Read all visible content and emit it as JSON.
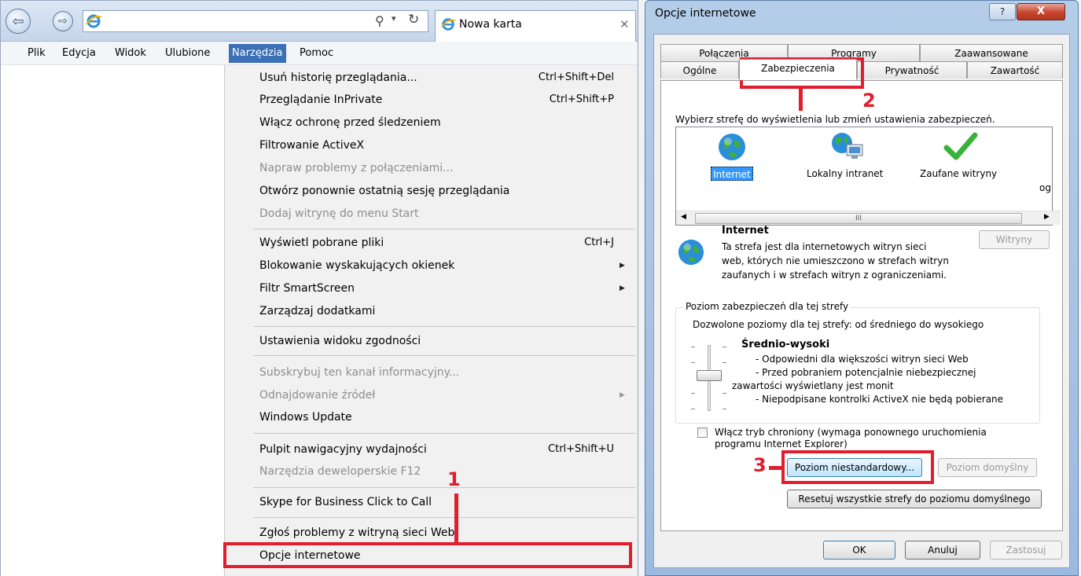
{
  "browser": {
    "tab_title": "Nowa karta",
    "menubar": [
      "Plik",
      "Edycja",
      "Widok",
      "Ulubione",
      "Narzędzia",
      "Pomoc"
    ],
    "tools_menu": [
      {
        "label": "Usuń historię przeglądania...",
        "shortcut": "Ctrl+Shift+Del"
      },
      {
        "label": "Przeglądanie InPrivate",
        "shortcut": "Ctrl+Shift+P"
      },
      {
        "label": "Włącz ochronę przed śledzeniem"
      },
      {
        "label": "Filtrowanie ActiveX"
      },
      {
        "label": "Napraw problemy z połączeniami...",
        "disabled": true
      },
      {
        "label": "Otwórz ponownie ostatnią sesję przeglądania"
      },
      {
        "label": "Dodaj witrynę do menu Start",
        "disabled": true
      },
      {
        "label": "Wyświetl pobrane pliki",
        "shortcut": "Ctrl+J"
      },
      {
        "label": "Blokowanie wyskakujących okienek",
        "submenu": true
      },
      {
        "label": "Filtr SmartScreen",
        "submenu": true
      },
      {
        "label": "Zarządzaj dodatkami"
      },
      {
        "label": "Ustawienia widoku zgodności"
      },
      {
        "label": "Subskrybuj ten kanał informacyjny...",
        "disabled": true
      },
      {
        "label": "Odnajdowanie źródeł",
        "disabled": true,
        "submenu": true
      },
      {
        "label": "Windows Update"
      },
      {
        "label": "Pulpit nawigacyjny wydajności",
        "shortcut": "Ctrl+Shift+U"
      },
      {
        "label": "Narzędzia deweloperskie F12",
        "disabled": true
      },
      {
        "label": "Skype for Business Click to Call"
      },
      {
        "label": "Zgłoś problemy z witryną sieci Web"
      },
      {
        "label": "Opcje internetowe"
      }
    ]
  },
  "dialog": {
    "title": "Opcje internetowe",
    "help_label": "?",
    "close_label": "X",
    "tabs_row1": [
      "Połączenia",
      "Programy",
      "Zaawansowane"
    ],
    "tabs_row2": [
      "Ogólne",
      "Zabezpieczenia",
      "Prywatność",
      "Zawartość"
    ],
    "zone_prompt": "Wybierz strefę do wyświetlenia lub zmień ustawienia zabezpieczeń.",
    "zones": [
      "Internet",
      "Lokalny intranet",
      "Zaufane witryny",
      "og"
    ],
    "scroll_marker": "III",
    "zone_title": "Internet",
    "zone_desc": [
      "Ta strefa jest dla internetowych witryn sieci",
      "web, których nie umieszczono w strefach witryn",
      "zaufanych i w strefach witryn z ograniczeniami."
    ],
    "sites_button": "Witryny",
    "level_group": "Poziom zabezpieczeń dla tej strefy",
    "allowed_levels": "Dozwolone poziomy dla tej strefy: od średniego do wysokiego",
    "level_name": "Średnio-wysoki",
    "level_desc": [
      "- Odpowiedni dla większości witryn sieci Web",
      "- Przed pobraniem potencjalnie niebezpiecznej",
      "zawartości wyświetlany jest monit",
      "- Niepodpisane kontrolki ActiveX nie będą pobierane"
    ],
    "protected_mode": [
      "Włącz tryb chroniony (wymaga ponownego uruchomienia",
      "programu Internet Explorer)"
    ],
    "custom_level": "Poziom niestandardowy...",
    "default_level": "Poziom domyślny",
    "reset_all": "Resetuj wszystkie strefy do poziomu domyślnego",
    "ok": "OK",
    "cancel": "Anuluj",
    "apply": "Zastosuj"
  },
  "annotations": {
    "n1": "1",
    "n2": "2",
    "n3": "3",
    "color": "#e01e2d"
  }
}
